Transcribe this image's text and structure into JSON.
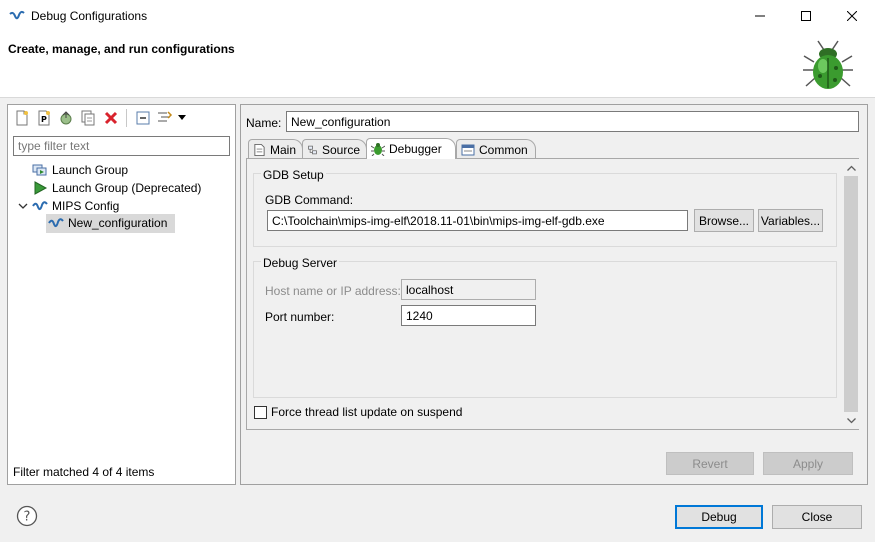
{
  "window": {
    "title": "Debug Configurations",
    "header": "Create, manage, and run configurations"
  },
  "left": {
    "filter_placeholder": "type filter text",
    "tree": [
      {
        "label": "Launch Group",
        "icon": "launch-group-icon"
      },
      {
        "label": "Launch Group (Deprecated)",
        "icon": "launch-deprecated-icon"
      },
      {
        "label": "MIPS Config",
        "icon": "mips-config-icon"
      },
      {
        "label": "New_configuration",
        "icon": "mips-configuration-icon"
      }
    ],
    "status": "Filter matched 4 of 4 items"
  },
  "right": {
    "name_label": "Name:",
    "name_value": "New_configuration",
    "tabs": [
      {
        "label": "Main",
        "icon": "main-tab-icon"
      },
      {
        "label": "Source",
        "icon": "source-tab-icon"
      },
      {
        "label": "Debugger",
        "icon": "debugger-tab-icon",
        "active": true
      },
      {
        "label": "Common",
        "icon": "common-tab-icon"
      }
    ],
    "gdb_setup": {
      "title": "GDB Setup",
      "command_label": "GDB Command:",
      "command_value": "C:\\Toolchain\\mips-img-elf\\2018.11-01\\bin\\mips-img-elf-gdb.exe",
      "browse_label": "Browse...",
      "variables_label": "Variables..."
    },
    "debug_server": {
      "title": "Debug Server",
      "host_label": "Host name or IP address:",
      "host_value": "localhost",
      "port_label": "Port number:",
      "port_value": "1240"
    },
    "force_thread_label": "Force thread list update on suspend",
    "revert_label": "Revert",
    "apply_label": "Apply"
  },
  "footer": {
    "debug_label": "Debug",
    "close_label": "Close"
  },
  "colors": {
    "accent": "#0078d7",
    "bug_green": "#3b9b2f"
  }
}
